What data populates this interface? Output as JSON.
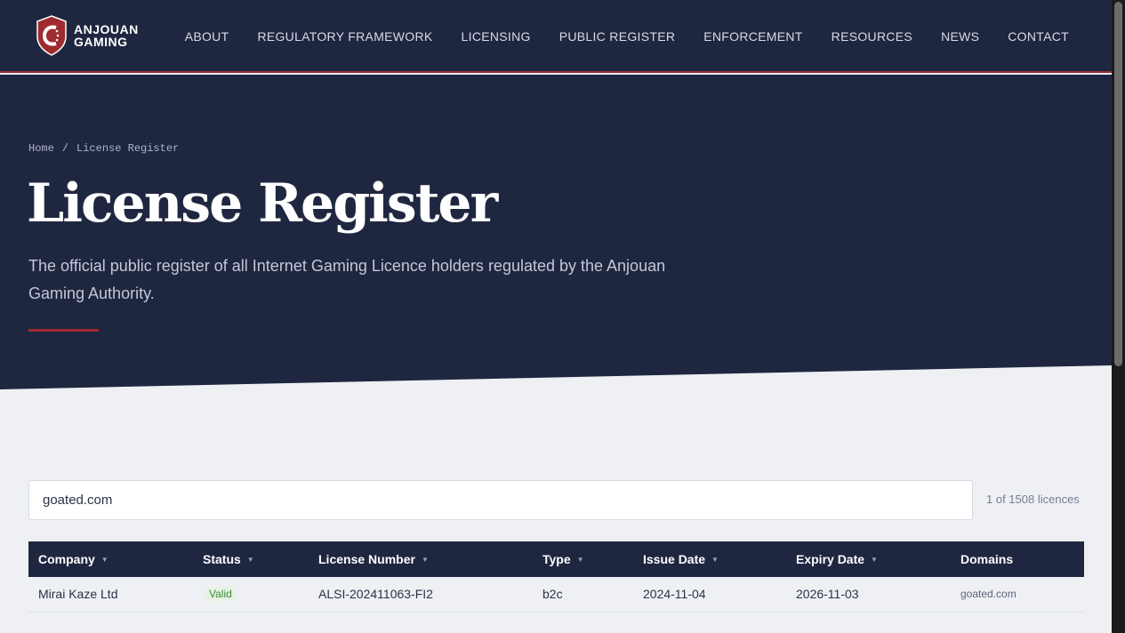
{
  "brand": {
    "line1": "ANJOUAN",
    "line2": "GAMING",
    "accent_color": "#9e2b2f",
    "navy_color": "#1f2740"
  },
  "nav": {
    "items": [
      "ABOUT",
      "REGULATORY FRAMEWORK",
      "LICENSING",
      "PUBLIC REGISTER",
      "ENFORCEMENT",
      "RESOURCES",
      "NEWS",
      "CONTACT"
    ]
  },
  "breadcrumb": {
    "home": "Home",
    "separator": "/",
    "current": "License Register"
  },
  "hero": {
    "title": "License Register",
    "subtitle": "The official public register of all Internet Gaming Licence holders regulated by the Anjouan Gaming Authority."
  },
  "search": {
    "value": "goated.com",
    "count_text": "1 of 1508 licences"
  },
  "table": {
    "columns": [
      "Company",
      "Status",
      "License Number",
      "Type",
      "Issue Date",
      "Expiry Date",
      "Domains"
    ],
    "rows": [
      {
        "company": "Mirai Kaze Ltd",
        "status": "Valid",
        "license_number": "ALSI-202411063-FI2",
        "type": "b2c",
        "issue_date": "2024-11-04",
        "expiry_date": "2026-11-03",
        "domains": "goated.com"
      }
    ]
  }
}
